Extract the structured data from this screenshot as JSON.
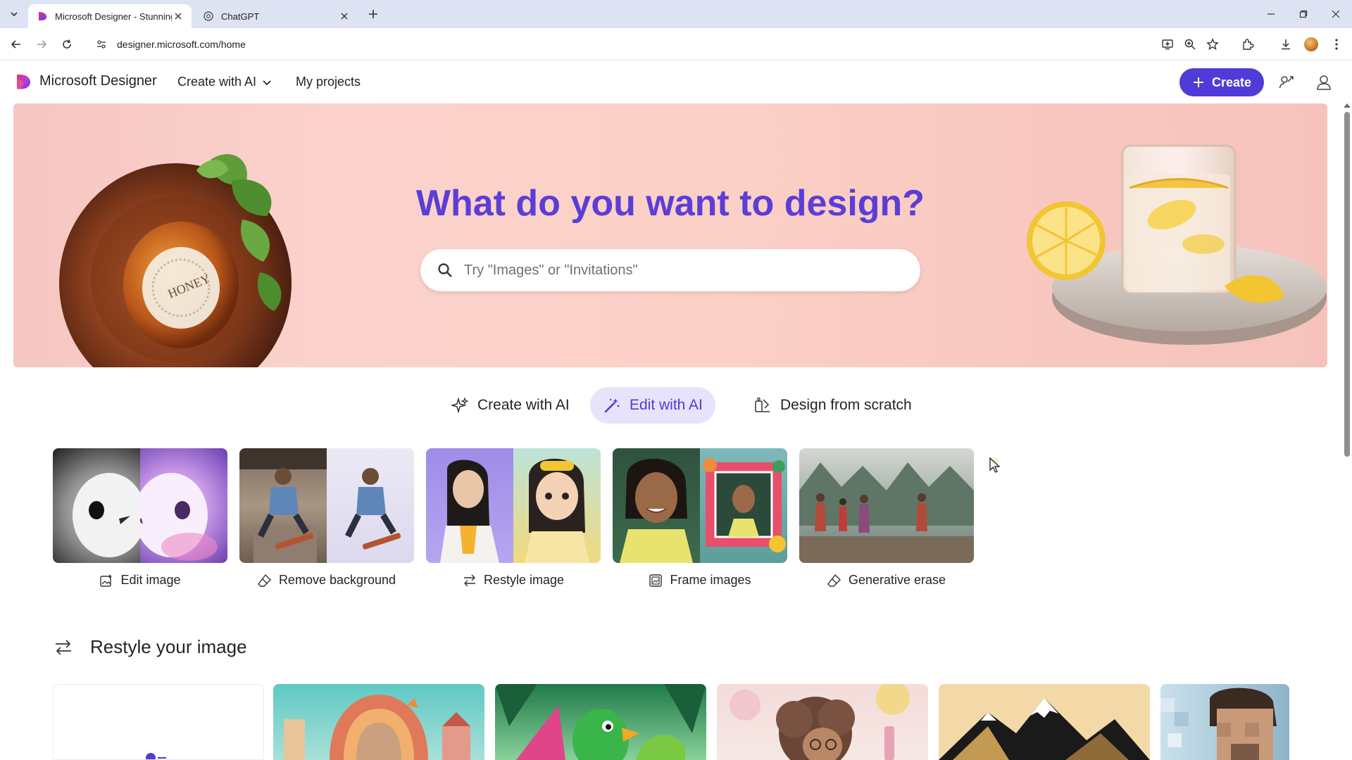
{
  "browser": {
    "tabs": [
      {
        "title": "Microsoft Designer - Stunning",
        "active": true
      },
      {
        "title": "ChatGPT",
        "active": false
      }
    ],
    "url": "designer.microsoft.com/home",
    "icons": [
      "tab-list-icon",
      "new-tab-icon",
      "minimize-icon",
      "restore-icon",
      "close-window-icon",
      "back-icon",
      "forward-icon",
      "reload-icon",
      "site-info-icon",
      "install-app-icon",
      "zoom-icon",
      "bookmark-star-icon",
      "extensions-icon",
      "downloads-icon",
      "profile-avatar",
      "browser-menu-icon"
    ]
  },
  "header": {
    "brand": "Microsoft Designer",
    "menu_create": "Create with AI",
    "menu_projects": "My projects",
    "create_button": "Create",
    "icons": [
      "share-icon",
      "account-icon"
    ]
  },
  "hero": {
    "title": "What do you want to design?",
    "search_placeholder": "Try \"Images\" or \"Invitations\"",
    "jar_label": "HONEY"
  },
  "modes": [
    {
      "label": "Create with AI",
      "icon": "sparkle-icon",
      "selected": false
    },
    {
      "label": "Edit with AI",
      "icon": "magic-wand-icon",
      "selected": true
    },
    {
      "label": "Design from scratch",
      "icon": "design-icon",
      "selected": false
    }
  ],
  "features": [
    {
      "label": "Edit image",
      "icon": "image-edit-icon"
    },
    {
      "label": "Remove background",
      "icon": "eraser-icon"
    },
    {
      "label": "Restyle image",
      "icon": "swap-arrows-icon"
    },
    {
      "label": "Frame images",
      "icon": "frame-icon"
    },
    {
      "label": "Generative erase",
      "icon": "eraser-icon"
    }
  ],
  "restyle_section": {
    "title": "Restyle your image",
    "icon": "swap-arrows-icon",
    "card_count": 6
  },
  "colors": {
    "accent": "#4f3bd8",
    "hero_title": "#5a3ed6",
    "selected_mode_bg": "#e9e2fb",
    "tabstrip": "#dde3f3"
  }
}
